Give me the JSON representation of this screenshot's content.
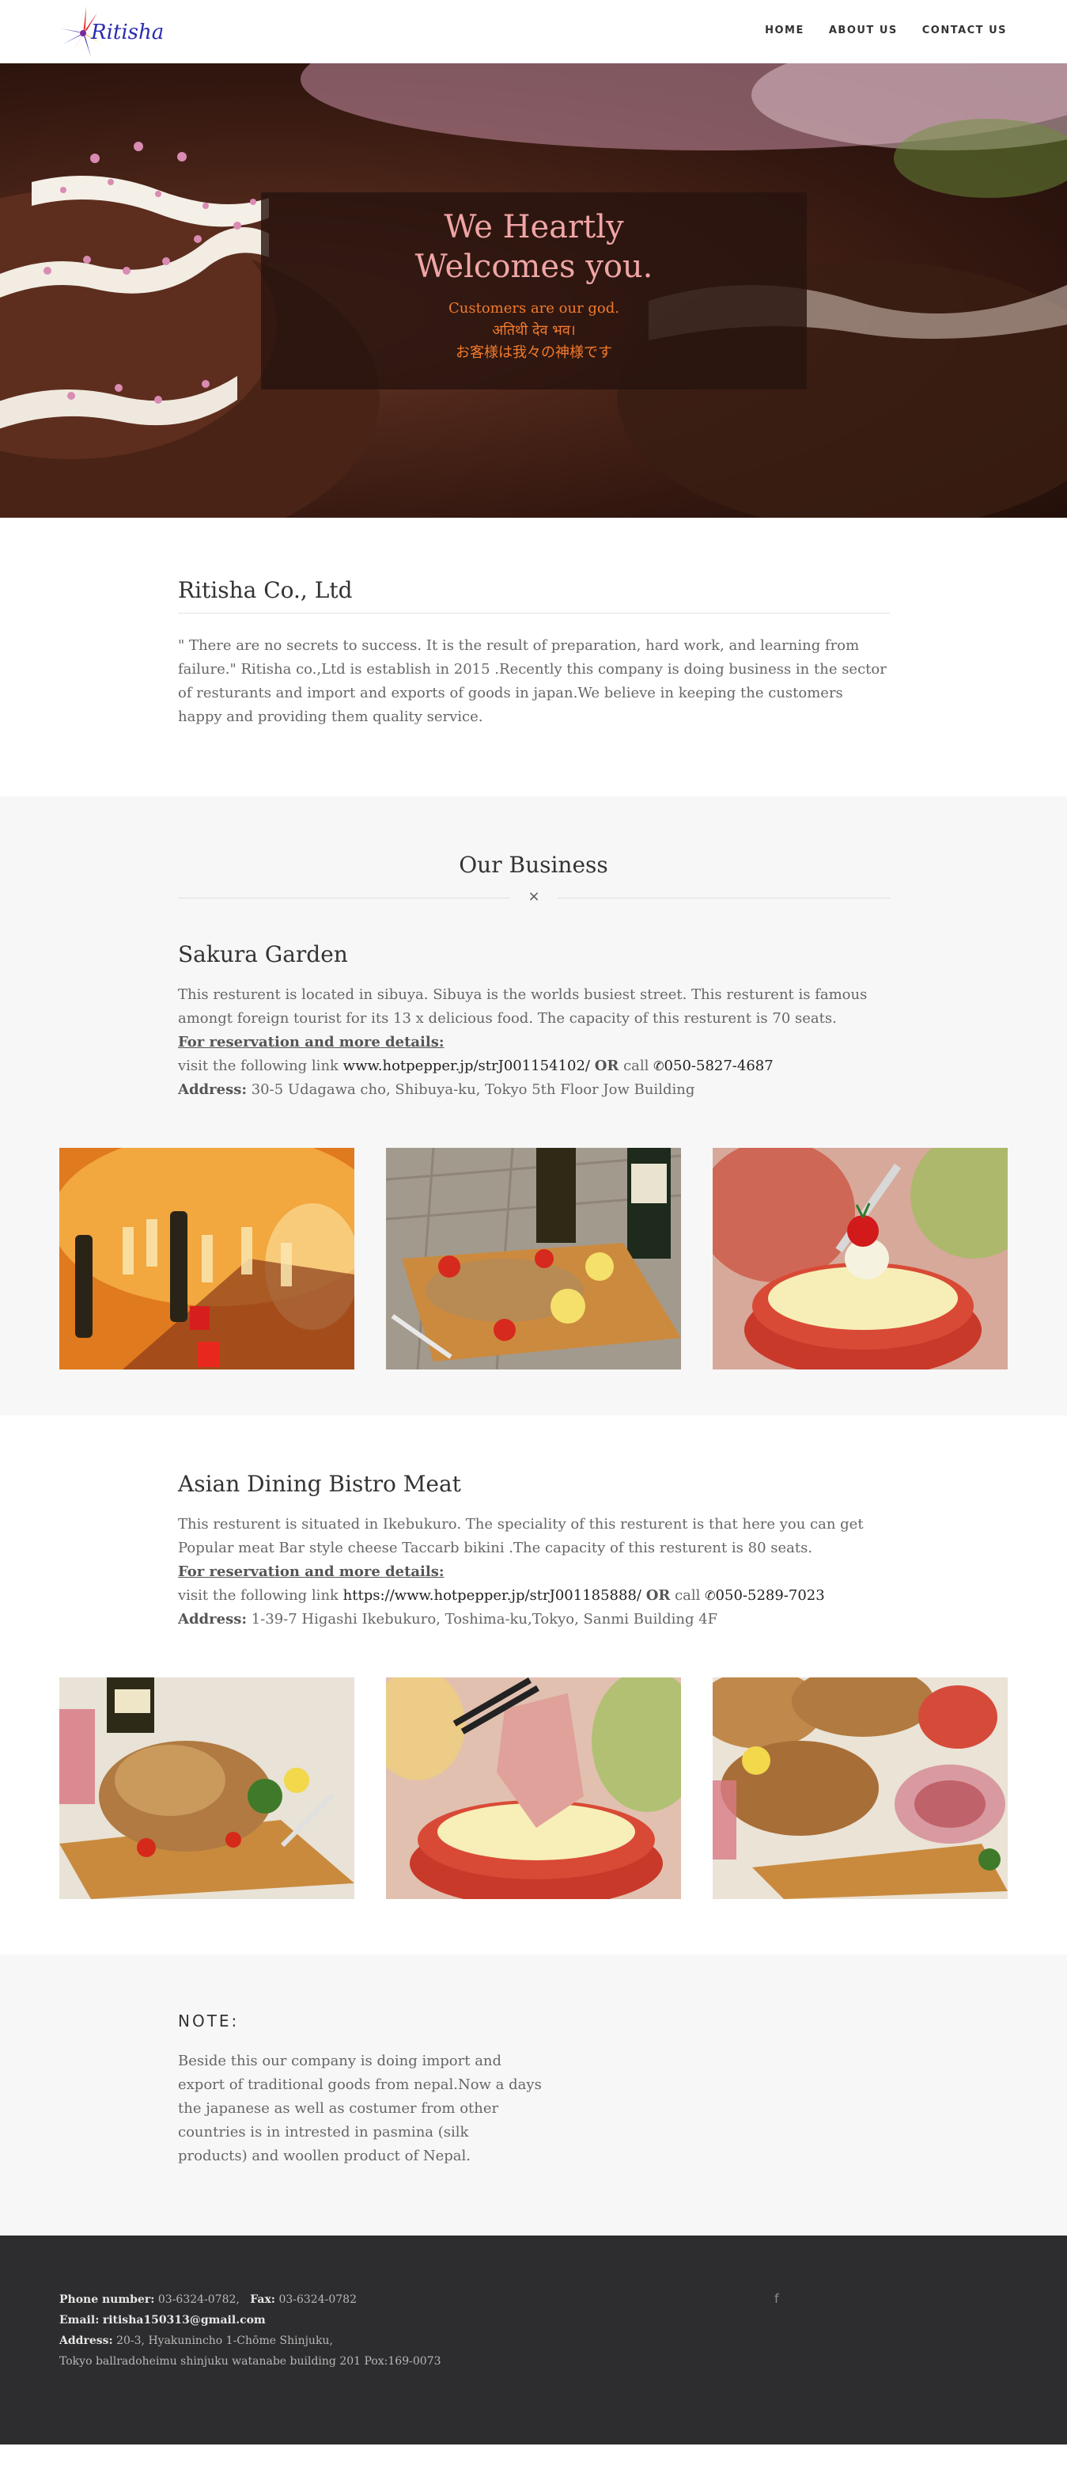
{
  "nav": {
    "logo_text": "Ritisha",
    "links": [
      "HOME",
      "ABOUT US",
      "CONTACT US"
    ]
  },
  "hero": {
    "title": "We Heartly Welcomes you.",
    "lines": [
      "Customers are our god.",
      "अतिथी देव भव।",
      "お客様は我々の神様です"
    ]
  },
  "about": {
    "title": "Ritisha Co., Ltd",
    "text": "\" There are no secrets to success. It is the result of preparation, hard work, and learning from failure.\" Ritisha co.,Ltd is establish in 2015 .Recently this company is doing business in the sector of resturants and import and exports of goods in japan.We believe in keeping the customers happy and providing them quality service."
  },
  "business": {
    "title": "Our Business",
    "divider_glyph": "×",
    "items": [
      {
        "name": "Sakura Garden",
        "desc": "This resturent is located in sibuya. Sibuya is the worlds busiest street. This resturent is famous amongt foreign tourist for its 13 x delicious food. The capacity of this resturent is 70 seats.",
        "reservation_label": "For reservation and more details:",
        "link_prefix": "visit the following link ",
        "link": "www.hotpepper.jp/strJ001154102/",
        "or": "OR",
        "call": "call",
        "phone": "050-5827-4687",
        "address_label": "Address:",
        "address": "30-5 Udagawa cho, Shibuya-ku, Tokyo 5th Floor Jow Building"
      },
      {
        "name": "Asian Dining Bistro Meat",
        "desc": "This resturent is situated in Ikebukuro. The speciality of this resturent is that here you can get Popular meat Bar style cheese Taccarb bikini .The capacity of this resturent is 80 seats.",
        "reservation_label": "For reservation and more details:",
        "link_prefix": "visit the following link ",
        "link": "https://www.hotpepper.jp/strJ001185888/",
        "or": "OR",
        "call": "call",
        "phone": "050-5289-7023",
        "address_label": "Address:",
        "address": "1-39-7 Higashi Ikebukuro, Toshima-ku,Tokyo, Sanmi Building 4F"
      }
    ]
  },
  "note": {
    "title": "NOTE:",
    "text": "Beside this our company is doing import and export of traditional goods from nepal.Now a days the japanese as well as costumer from other countries is in intrested in pasmina (silk products) and woollen product of Nepal."
  },
  "footer": {
    "phone_label": "Phone number:",
    "phone": "03-6324-0782,",
    "fax_label": "Fax:",
    "fax": "03-6324-0782",
    "email_label": "Email:",
    "email": "ritisha150313@gmail.com",
    "address_label": "Address:",
    "address1": "20-3, Hyakunincho 1-Chōme Shinjuku,",
    "address2": "Tokyo ballradoheimu shinjuku watanabe building 201 Pox:169-0073",
    "social_icon": "f"
  }
}
